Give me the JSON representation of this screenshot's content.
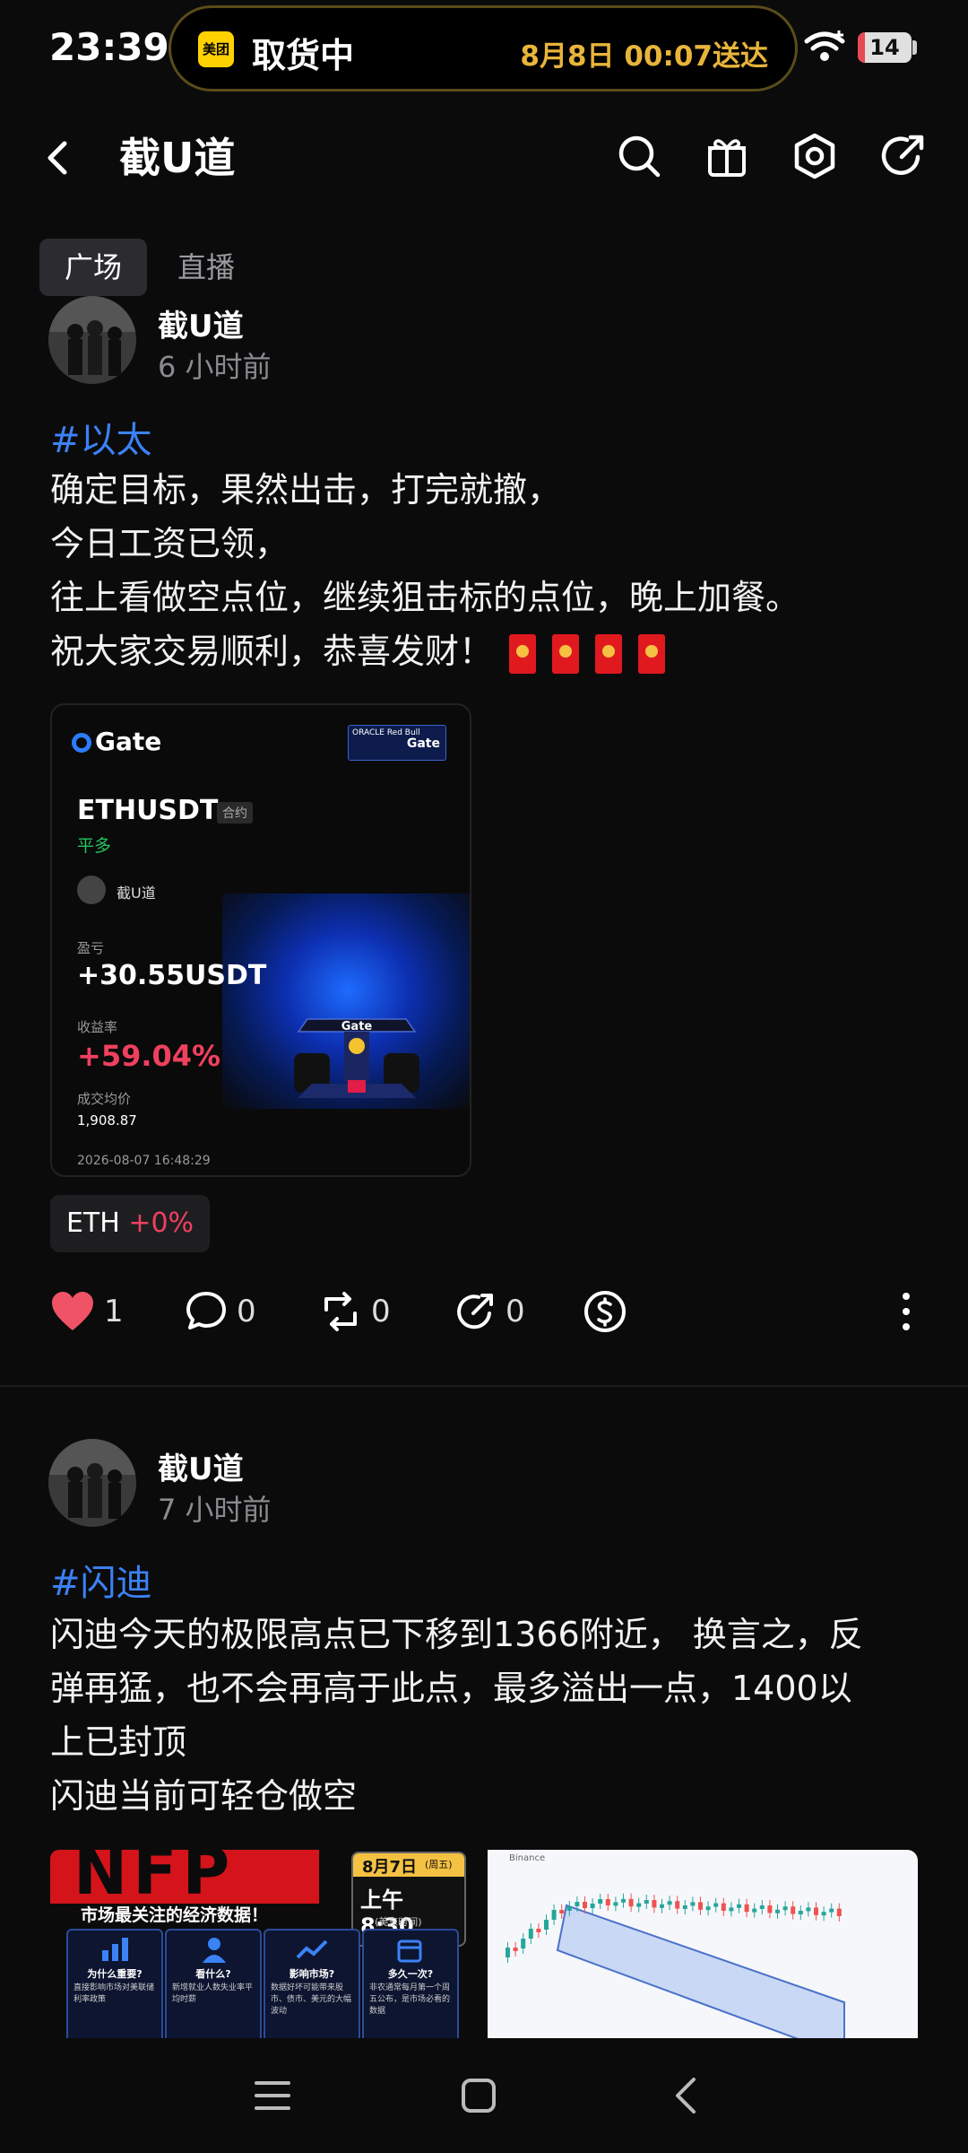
{
  "status_bar": {
    "time": "23:39",
    "island": {
      "app_badge": "美团",
      "status": "取货中",
      "eta": "8月8日 00:07送达"
    },
    "battery": "14",
    "battery_level": 0.14
  },
  "header": {
    "title": "截U道"
  },
  "tabs": [
    {
      "label": "广场",
      "active": true
    },
    {
      "label": "直播",
      "active": false
    }
  ],
  "posts": [
    {
      "username": "截U道",
      "time": "6 小时前",
      "tag": "#以太",
      "lines": [
        "确定目标，果然出击，打完就撤，",
        "今日工资已领，",
        "往上看做空点位，继续狙击标的点位，晚上加餐。",
        "祝大家交易顺利，恭喜发财！"
      ],
      "card": {
        "brand": "Gate",
        "sponsor_text": "ORACLE Red Bull",
        "sponsor_brand": "Gate",
        "pair": "ETHUSDT",
        "contract": "合约",
        "side": "平多",
        "trader": "截U道",
        "pnl_label": "盈亏",
        "pnl": "+30.55USDT",
        "roi_label": "收益率",
        "roi": "+59.04%",
        "avg_label": "成交均价",
        "avg_price": "1,908.87",
        "datetime": "2026-08-07 16:48:29",
        "car_text": "Gate"
      },
      "ticker": {
        "symbol": "ETH",
        "change": "+0%"
      },
      "actions": {
        "likes": "1",
        "comments": "0",
        "reposts": "0",
        "shares": "0"
      }
    },
    {
      "username": "截U道",
      "time": "7 小时前",
      "tag": "#闪迪",
      "lines": [
        "闪迪今天的极限高点已下移到1366附近， 换言之，反",
        "弹再猛，也不会再高于此点，最多溢出一点，1400以",
        "上已封顶",
        "闪迪当前可轻仓做空"
      ],
      "image1": {
        "title": "NFP",
        "date": "8月7日",
        "weekday": "(周五)",
        "time": "上午 8:30",
        "tz": "(美东时间)",
        "banner": "市场最关注的经济数据！",
        "cols": [
          {
            "title": "为什么重要?",
            "text": "直接影响市场对美联储利率政策"
          },
          {
            "title": "看什么?",
            "text": "新增就业人数失业率平均时薪"
          },
          {
            "title": "影响市场?",
            "text": "数据好坏可能带来股市、债市、美元的大幅波动"
          },
          {
            "title": "多久一次?",
            "text": "非农通常每月第一个周五公布，是市场必看的数据"
          }
        ]
      },
      "image2": {
        "source": "Binance"
      }
    }
  ],
  "colors": {
    "accent_blue": "#3b82f6",
    "like_red": "#f05266",
    "roi_red": "#f0405f",
    "island_gold": "#e8b43a"
  }
}
